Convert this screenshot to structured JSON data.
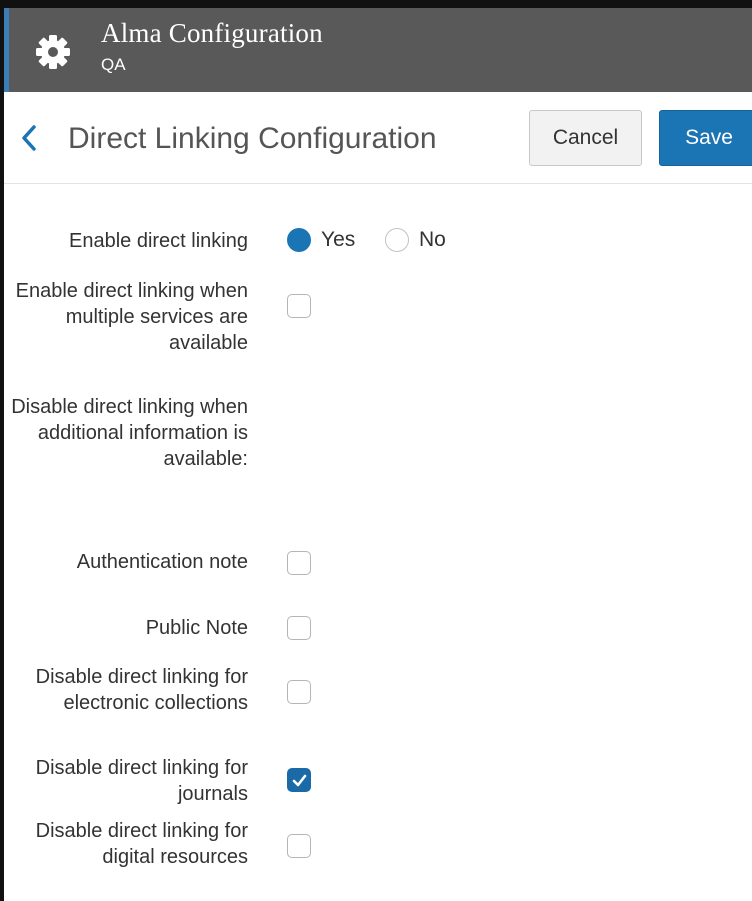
{
  "header": {
    "app_title": "Alma Configuration",
    "subtitle": "QA",
    "icon": "gear-icon"
  },
  "title_bar": {
    "back_icon": "chevron-left-icon",
    "page_title": "Direct Linking Configuration",
    "cancel_label": "Cancel",
    "save_label": "Save"
  },
  "form": {
    "enable_direct_linking": {
      "label": "Enable direct linking",
      "options": [
        "Yes",
        "No"
      ],
      "selected": "Yes"
    },
    "multiple_services": {
      "label": "Enable direct linking when multiple services are available",
      "checked": false
    },
    "disable_additional_info_heading": "Disable direct linking when additional information is available:",
    "authentication_note": {
      "label": "Authentication note",
      "checked": false
    },
    "public_note": {
      "label": "Public Note",
      "checked": false
    },
    "electronic_collections": {
      "label": "Disable direct linking for electronic collections",
      "checked": false
    },
    "journals": {
      "label": "Disable direct linking for journals",
      "checked": true
    },
    "digital_resources": {
      "label": "Disable direct linking for digital resources",
      "checked": false
    }
  },
  "colors": {
    "header_bg": "#595959",
    "accent": "#1b74b3",
    "header_stripe": "#3a7fb8"
  }
}
